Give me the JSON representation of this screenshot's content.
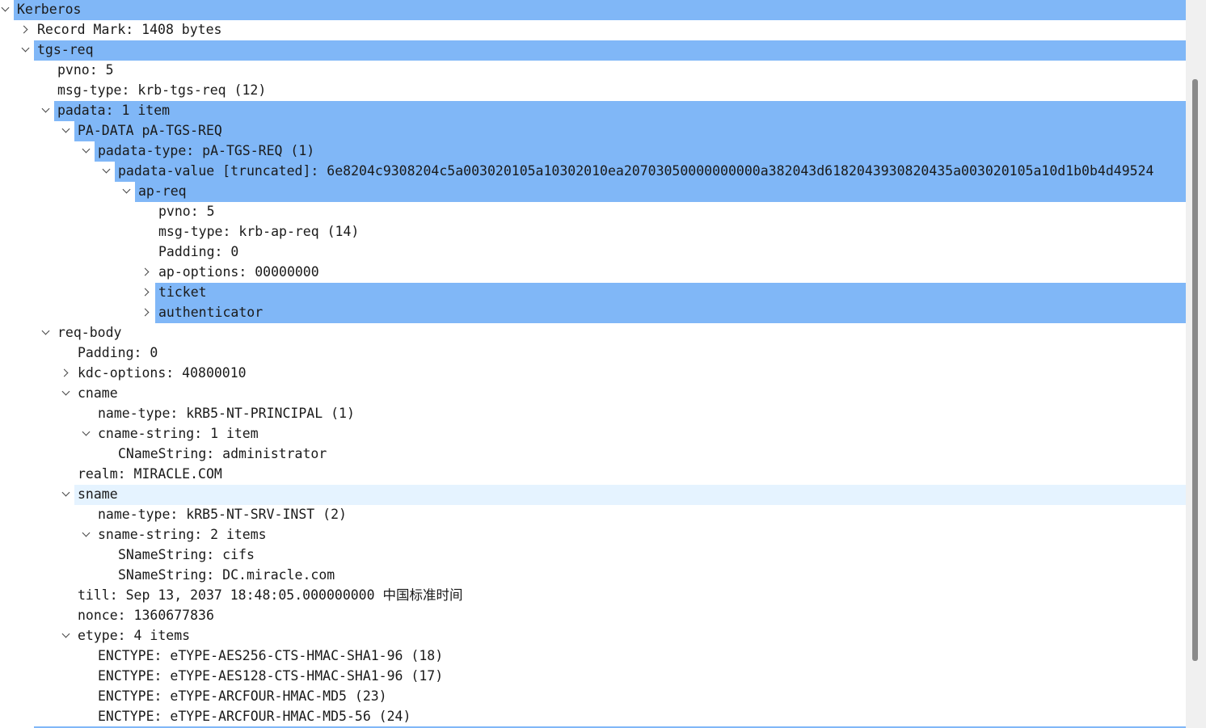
{
  "tree": [
    {
      "level": 0,
      "toggle": "open",
      "label": "Kerberos",
      "state": "hl"
    },
    {
      "level": 1,
      "toggle": "closed",
      "label": "Record Mark: 1408 bytes"
    },
    {
      "level": 1,
      "toggle": "open",
      "label": "tgs-req",
      "state": "hl"
    },
    {
      "level": 2,
      "label": "pvno: 5"
    },
    {
      "level": 2,
      "label": "msg-type: krb-tgs-req (12)"
    },
    {
      "level": 2,
      "toggle": "open",
      "label": "padata: 1 item",
      "state": "hl"
    },
    {
      "level": 3,
      "toggle": "open",
      "label": "PA-DATA pA-TGS-REQ",
      "state": "hl"
    },
    {
      "level": 4,
      "toggle": "open",
      "label": "padata-type: pA-TGS-REQ (1)",
      "state": "hl"
    },
    {
      "level": 5,
      "toggle": "open",
      "label": "padata-value [truncated]: 6e8204c9308204c5a003020105a10302010ea20703050000000000a382043d6182043930820435a003020105a10d1b0b4d49524",
      "state": "hl"
    },
    {
      "level": 6,
      "toggle": "open",
      "label": "ap-req",
      "state": "hl"
    },
    {
      "level": 7,
      "label": "pvno: 5"
    },
    {
      "level": 7,
      "label": "msg-type: krb-ap-req (14)"
    },
    {
      "level": 7,
      "label": "Padding: 0"
    },
    {
      "level": 7,
      "toggle": "closed",
      "label": "ap-options: 00000000"
    },
    {
      "level": 7,
      "toggle": "closed",
      "label": "ticket",
      "state": "hl"
    },
    {
      "level": 7,
      "toggle": "closed",
      "label": "authenticator",
      "state": "hl"
    },
    {
      "level": 2,
      "toggle": "open",
      "label": "req-body"
    },
    {
      "level": 3,
      "label": "Padding: 0"
    },
    {
      "level": 3,
      "toggle": "closed",
      "label": "kdc-options: 40800010"
    },
    {
      "level": 3,
      "toggle": "open",
      "label": "cname"
    },
    {
      "level": 4,
      "label": "name-type: kRB5-NT-PRINCIPAL (1)"
    },
    {
      "level": 4,
      "toggle": "open",
      "label": "cname-string: 1 item"
    },
    {
      "level": 5,
      "label": "CNameString: administrator"
    },
    {
      "level": 3,
      "label": "realm: MIRACLE.COM"
    },
    {
      "level": 3,
      "toggle": "open",
      "label": "sname",
      "state": "hover"
    },
    {
      "level": 4,
      "label": "name-type: kRB5-NT-SRV-INST (2)"
    },
    {
      "level": 4,
      "toggle": "open",
      "label": "sname-string: 2 items"
    },
    {
      "level": 5,
      "label": "SNameString: cifs"
    },
    {
      "level": 5,
      "label": "SNameString: DC.miracle.com"
    },
    {
      "level": 3,
      "label": "till: Sep 13, 2037 18:48:05.000000000 中国标准时间"
    },
    {
      "level": 3,
      "label": "nonce: 1360677836"
    },
    {
      "level": 3,
      "toggle": "open",
      "label": "etype: 4 items"
    },
    {
      "level": 4,
      "label": "ENCTYPE: eTYPE-AES256-CTS-HMAC-SHA1-96 (18)"
    },
    {
      "level": 4,
      "label": "ENCTYPE: eTYPE-AES128-CTS-HMAC-SHA1-96 (17)"
    },
    {
      "level": 4,
      "label": "ENCTYPE: eTYPE-ARCFOUR-HMAC-MD5 (23)"
    },
    {
      "level": 4,
      "label": "ENCTYPE: eTYPE-ARCFOUR-HMAC-MD5-56 (24)"
    }
  ],
  "colors": {
    "selection": "#80b7f7",
    "hover": "#e5f3ff",
    "scrollbar_track": "#f0f0f0",
    "scrollbar_thumb": "#8a8a8a"
  },
  "icons": {
    "expanded": "chevron-down-icon",
    "collapsed": "chevron-right-icon"
  }
}
